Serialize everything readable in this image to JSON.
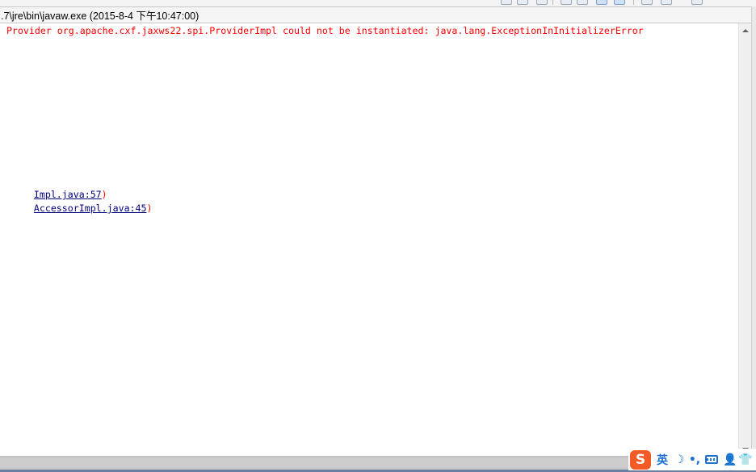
{
  "console": {
    "title": ".7\\jre\\bin\\javaw.exe (2015-8-4 下午10:47:00)",
    "error_line": " Provider org.apache.cxf.jaxws22.spi.ProviderImpl could not be instantiated: java.lang.ExceptionInInitializerError",
    "stack_lines": [
      {
        "link": "Impl.java:57",
        "suffix": ")"
      },
      {
        "link": "AccessorImpl.java:45",
        "suffix": ")"
      }
    ]
  },
  "ime": {
    "logo_glyph": "S",
    "lang_label": "英",
    "moon_glyph": "☽",
    "punct_glyph": "•,",
    "user_glyph": "👤",
    "skin_glyph": "👕"
  },
  "colors": {
    "error_text": "#ff0000",
    "link_text": "#00007f",
    "ime_accent": "#1b6fd1",
    "ime_logo": "#f35a25"
  },
  "icons": [
    "scroll-up-icon",
    "scroll-down-icon",
    "keyboard-icon",
    "sogou-logo-icon",
    "moon-icon",
    "user-icon",
    "shirt-icon"
  ]
}
